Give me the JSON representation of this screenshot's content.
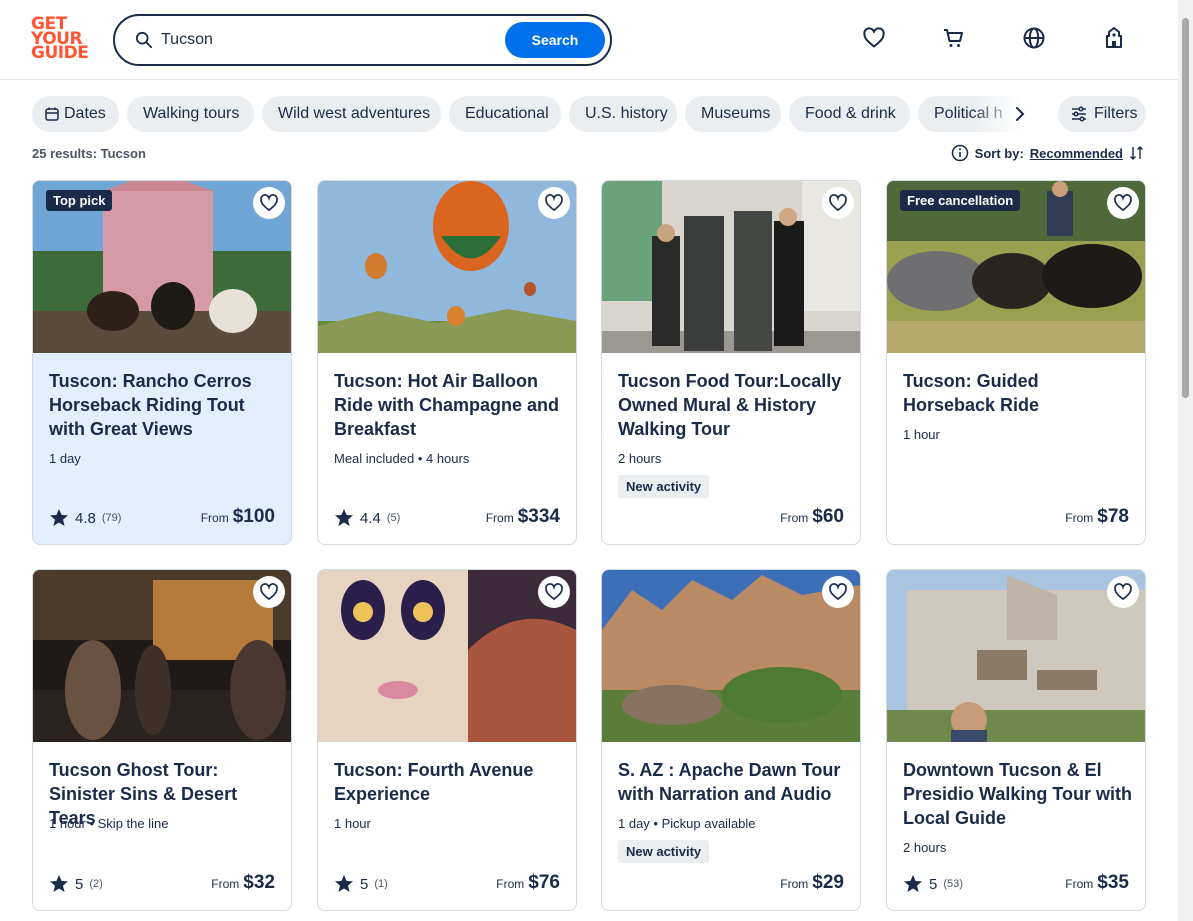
{
  "header": {
    "logo_lines": [
      "GET",
      "YOUR",
      "GUIDE"
    ],
    "search_value": "Tucson",
    "search_button": "Search",
    "icons": [
      "heart-icon",
      "cart-icon",
      "globe-icon",
      "account-icon"
    ]
  },
  "chips": {
    "dates": "Dates",
    "items": [
      "Walking tours",
      "Wild west adventures",
      "Educational",
      "U.S. history",
      "Museums",
      "Food & drink",
      "Political h"
    ],
    "filters": "Filters"
  },
  "results": {
    "count_text": "25 results: Tucson",
    "sort_label": "Sort by:",
    "sort_value": "Recommended"
  },
  "cards": [
    {
      "badge": "Top pick",
      "title": "Tuscon: Rancho Cerros Horseback Riding Tout with Great Views",
      "meta": "1 day",
      "new": "",
      "rating": "4.8",
      "count": "(79)",
      "from": "From",
      "price": "$100"
    },
    {
      "badge": "",
      "title": "Tucson: Hot Air Balloon Ride with Champagne and Breakfast",
      "meta": "Meal included • 4 hours",
      "new": "",
      "rating": "4.4",
      "count": "(5)",
      "from": "From",
      "price": "$334"
    },
    {
      "badge": "",
      "title": "Tucson Food Tour:Locally Owned Mural & History Walking Tour",
      "meta": "2 hours",
      "new": "New activity",
      "rating": "",
      "count": "",
      "from": "From",
      "price": "$60"
    },
    {
      "badge": "Free cancellation",
      "title": "Tucson: Guided Horseback Ride",
      "meta": "1 hour",
      "new": "",
      "rating": "",
      "count": "",
      "from": "From",
      "price": "$78"
    },
    {
      "badge": "",
      "title": "Tucson Ghost Tour: Sinister Sins & Desert Tears",
      "meta": "1 hour • Skip the line",
      "new": "",
      "rating": "5",
      "count": "(2)",
      "from": "From",
      "price": "$32"
    },
    {
      "badge": "",
      "title": "Tucson: Fourth Avenue Experience",
      "meta": "1 hour",
      "new": "",
      "rating": "5",
      "count": "(1)",
      "from": "From",
      "price": "$76"
    },
    {
      "badge": "",
      "title": "S. AZ : Apache Dawn Tour with Narration and Audio",
      "meta": "1 day • Pickup available",
      "new": "New activity",
      "rating": "",
      "count": "",
      "from": "From",
      "price": "$29"
    },
    {
      "badge": "",
      "title": "Downtown Tucson & El Presidio Walking Tour with Local Guide",
      "meta": "2 hours",
      "new": "",
      "rating": "5",
      "count": "(53)",
      "from": "From",
      "price": "$35"
    }
  ],
  "colors": {
    "brand": "#ff5533",
    "primary": "#0071eb",
    "text": "#1a2b49"
  }
}
